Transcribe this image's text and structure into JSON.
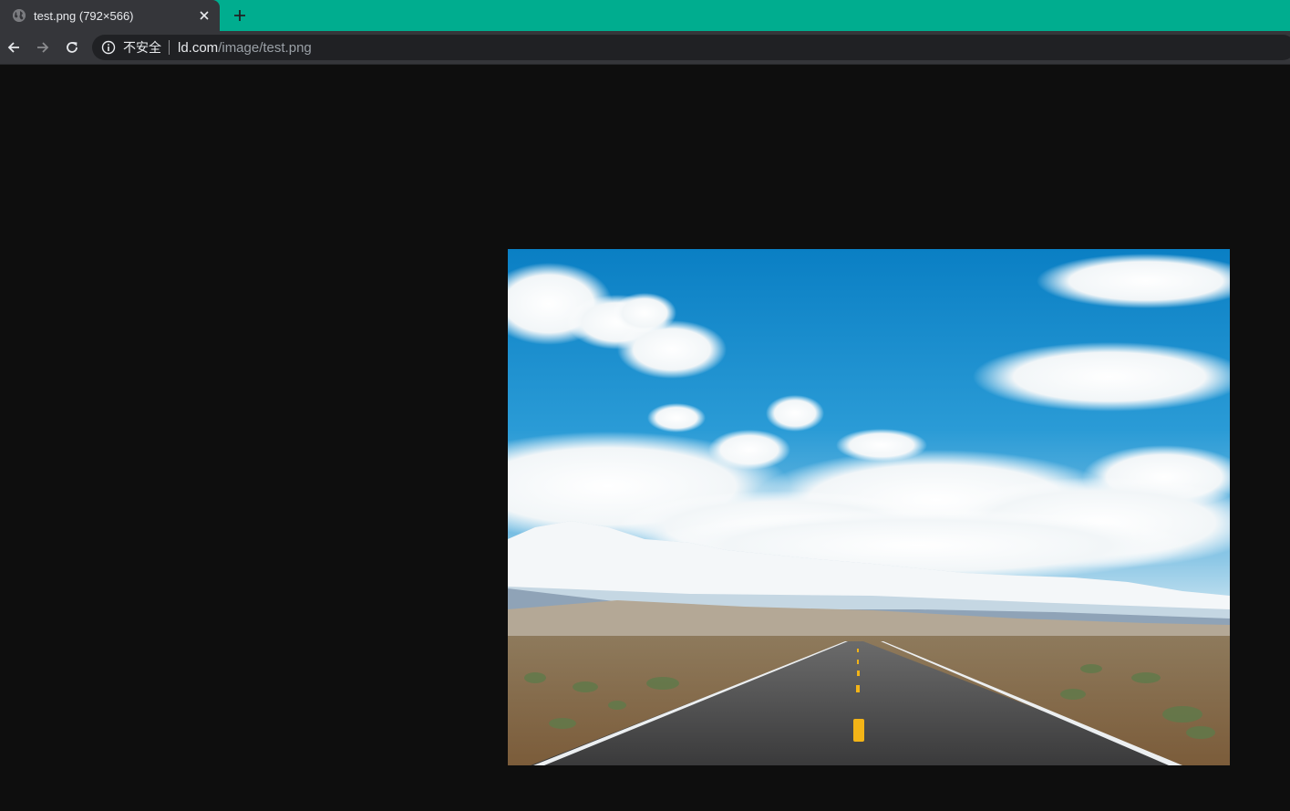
{
  "tab": {
    "title": "test.png (792×566)",
    "favicon": "globe-icon",
    "close_icon": "close-icon"
  },
  "new_tab_icon": "plus-icon",
  "nav": {
    "back_icon": "arrow-left-icon",
    "forward_icon": "arrow-right-icon",
    "reload_icon": "reload-icon"
  },
  "omnibox": {
    "info_icon": "info-icon",
    "security_text": "不安全",
    "host": "ld.com",
    "path": "/image/test.png"
  },
  "colors": {
    "tabstrip": "#00ad8f",
    "toolbar": "#35363a",
    "page_background": "#0e0e0e",
    "road_center_line": "#f3b417"
  },
  "image": {
    "description_icon": "landscape-road-photo"
  }
}
